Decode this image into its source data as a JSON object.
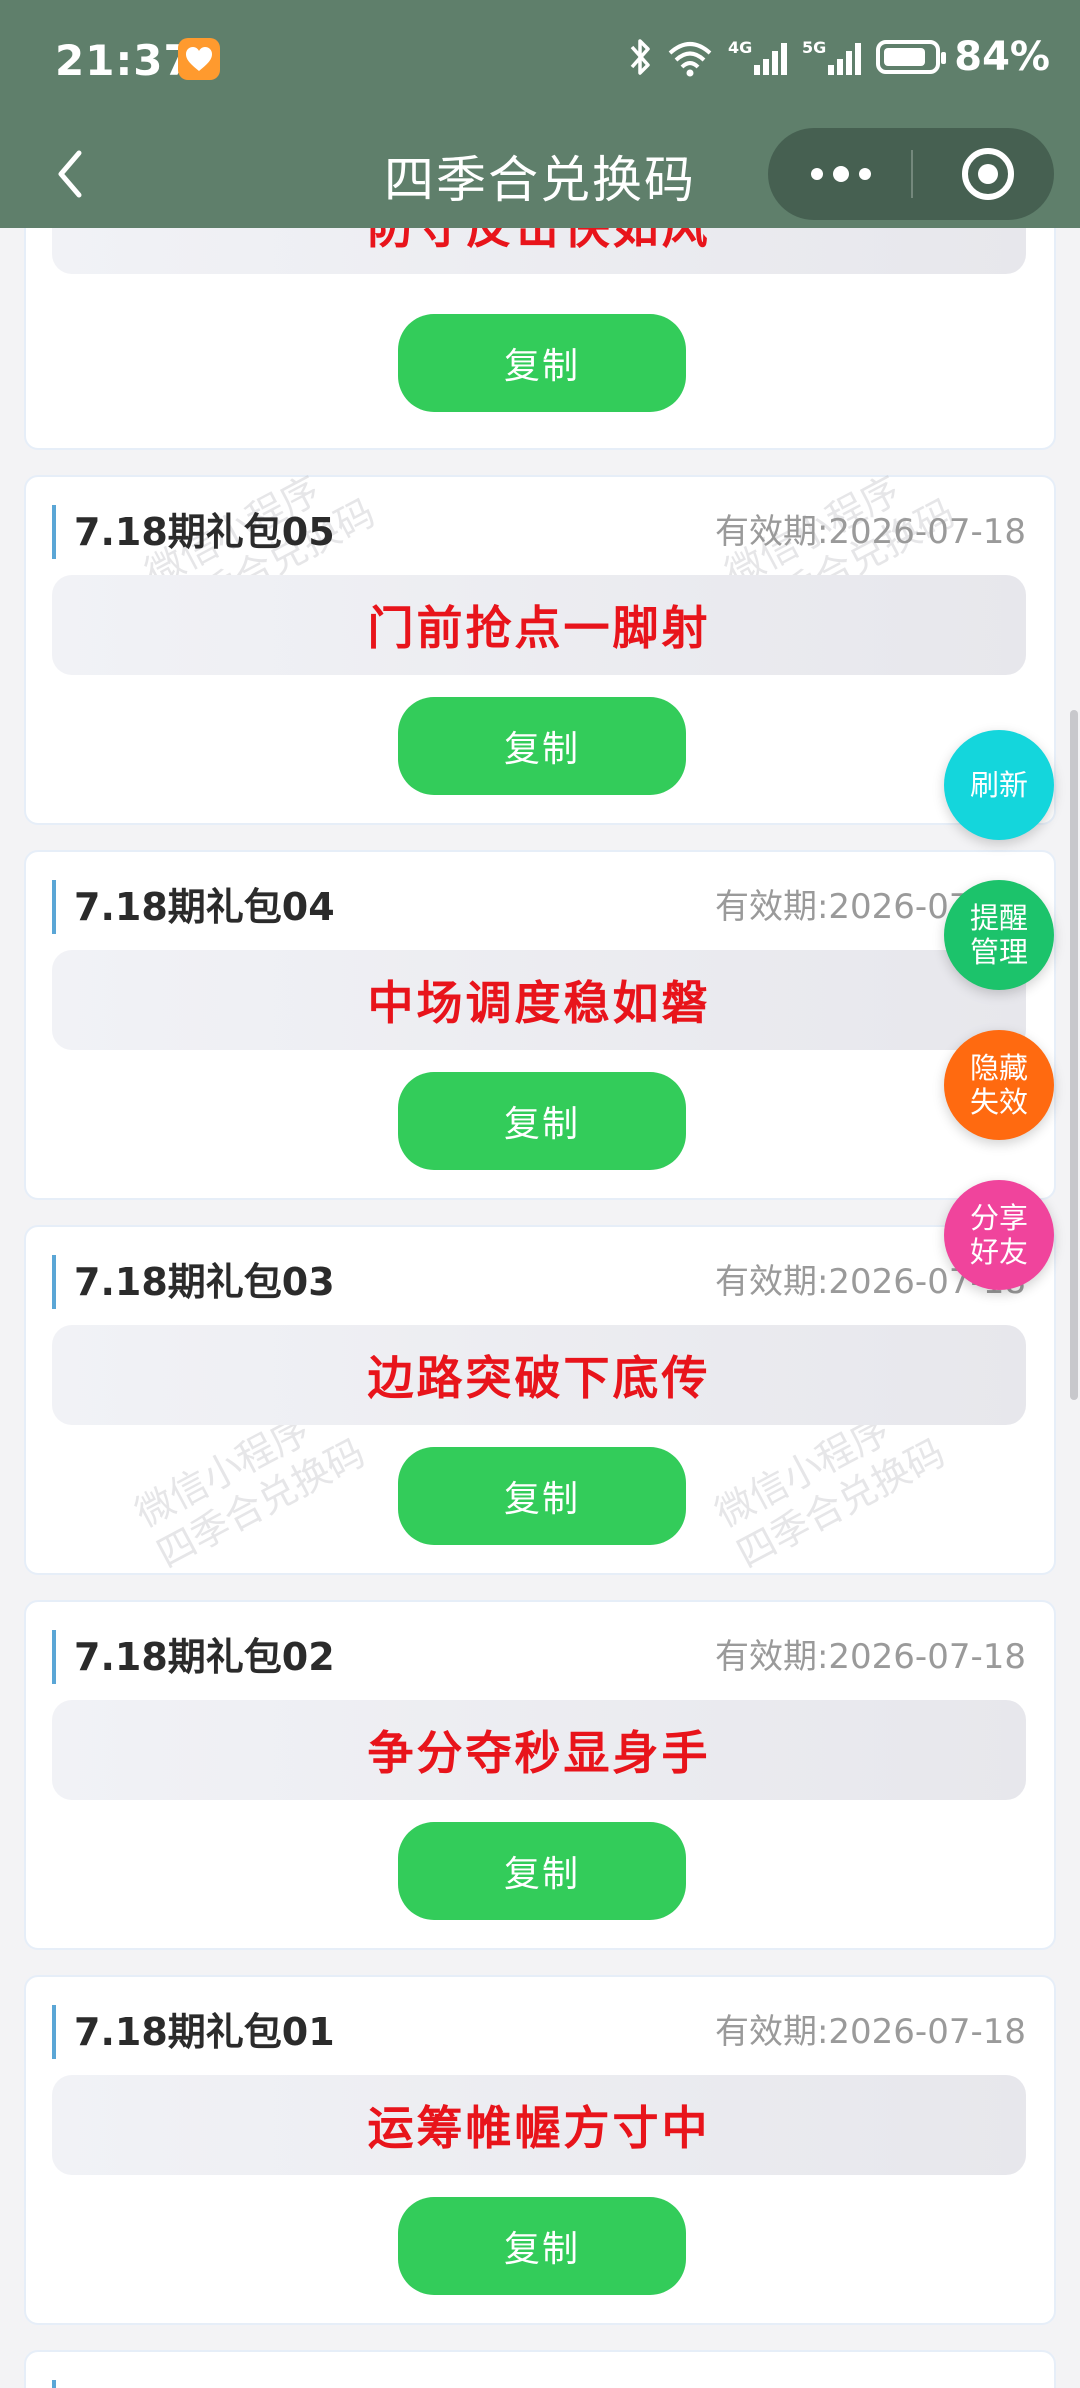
{
  "status": {
    "time": "21:37",
    "battery_text": "84%",
    "battery_level": 0.84
  },
  "nav": {
    "title": "四季合兑换码"
  },
  "cards": [
    {
      "title": "",
      "expire": "",
      "code": "防守反击快如风",
      "copy": "复制"
    },
    {
      "title": "7.18期礼包05",
      "expire": "有效期:2026-07-18",
      "code": "门前抢点一脚射",
      "copy": "复制"
    },
    {
      "title": "7.18期礼包04",
      "expire": "有效期:2026-07-18",
      "code": "中场调度稳如磐",
      "copy": "复制"
    },
    {
      "title": "7.18期礼包03",
      "expire": "有效期:2026-07-18",
      "code": "边路突破下底传",
      "copy": "复制"
    },
    {
      "title": "7.18期礼包02",
      "expire": "有效期:2026-07-18",
      "code": "争分夺秒显身手",
      "copy": "复制"
    },
    {
      "title": "7.18期礼包01",
      "expire": "有效期:2026-07-18",
      "code": "运筹帷幄方寸中",
      "copy": "复制"
    }
  ],
  "fabs": {
    "refresh": "刷新",
    "remind_l1": "提醒",
    "remind_l2": "管理",
    "hide_l1": "隐藏",
    "hide_l2": "失效",
    "share_l1": "分享",
    "share_l2": "好友"
  },
  "watermark": {
    "line1": "微信小程序",
    "line2": "四季合兑换码"
  },
  "colors": {
    "nav": "#5f7f6b",
    "code_text": "#e8141b",
    "copy_btn": "#33cc5a",
    "fab_refresh": "#14d6dc",
    "fab_remind": "#1cc36b",
    "fab_hide": "#ff6a10",
    "fab_share": "#f0449c"
  }
}
